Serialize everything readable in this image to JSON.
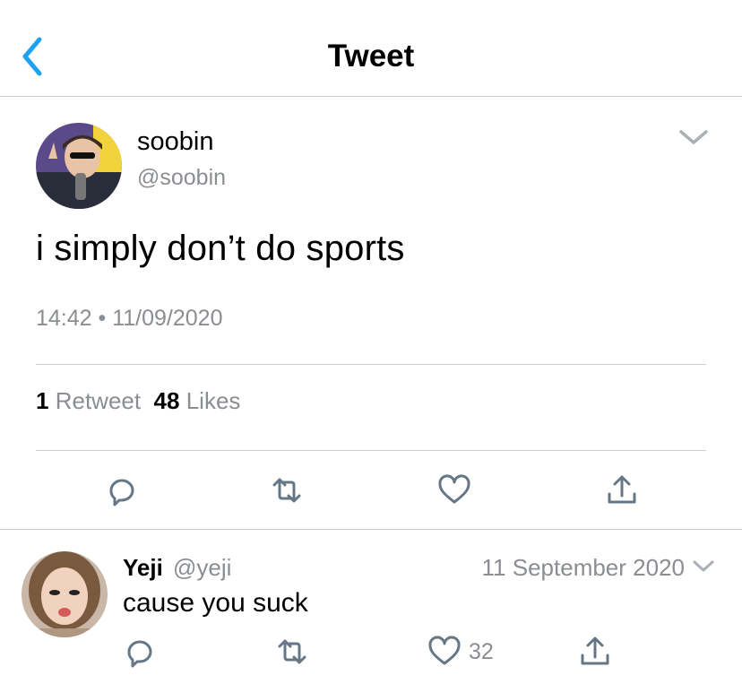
{
  "header": {
    "title": "Tweet",
    "back_icon": "chevron-left-icon"
  },
  "colors": {
    "accent": "#1da1f2",
    "icon_gray": "#657786",
    "text_gray": "#8a8d91"
  },
  "tweet": {
    "display_name": "soobin",
    "handle": "@soobin",
    "text": "i simply don’t do sports",
    "timestamp": "14:42 • 11/09/2020",
    "retweet_count": "1",
    "retweet_label": "Retweet",
    "like_count": "48",
    "like_label": "Likes",
    "actions": [
      "reply-icon",
      "retweet-icon",
      "like-icon",
      "share-icon"
    ]
  },
  "reply": {
    "display_name": "Yeji",
    "handle": "@yeji",
    "date": "11 September 2020",
    "text": "cause you suck",
    "like_count": "32",
    "actions": [
      "reply-icon",
      "retweet-icon",
      "like-icon",
      "share-icon"
    ]
  }
}
